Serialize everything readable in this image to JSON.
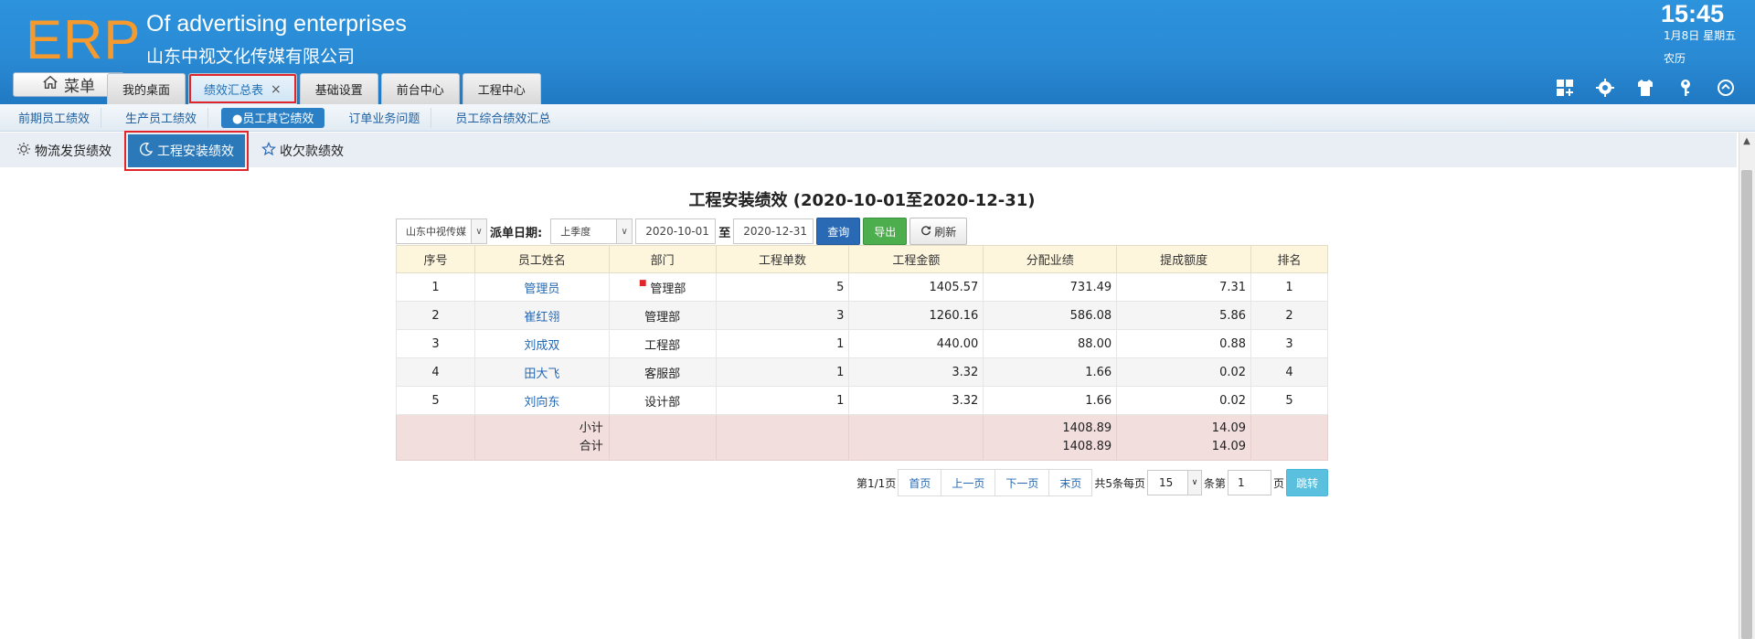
{
  "header": {
    "logo": "ERP",
    "company_en": "Of advertising enterprises",
    "company_cn": "山东中视文化传媒有限公司",
    "time": "15:45",
    "date": "1月8日 星期五",
    "lunar": "农历",
    "menu_label": "菜单",
    "tabs": [
      {
        "label": "我的桌面"
      },
      {
        "label": "绩效汇总表",
        "close": "×"
      },
      {
        "label": "基础设置"
      },
      {
        "label": "前台中心"
      },
      {
        "label": "工程中心"
      }
    ],
    "icons": [
      "apps-add-icon",
      "gear-icon",
      "shirt-icon",
      "key-icon",
      "collapse-up-icon"
    ]
  },
  "subnav": {
    "items": [
      "前期员工绩效",
      "生产员工绩效",
      "●员工其它绩效",
      "订单业务问题",
      "员工综合绩效汇总"
    ]
  },
  "section_tabs": {
    "items": [
      "物流发货绩效",
      "工程安装绩效",
      "收欠款绩效"
    ]
  },
  "report": {
    "title": "工程安装绩效 (2020-10-01至2020-12-31)",
    "filters": {
      "company_value": "山东中视传媒",
      "date_label": "派单日期:",
      "period_value": "上季度",
      "start_date": "2020-10-01",
      "to_label": "至",
      "end_date": "2020-12-31",
      "query_label": "查询",
      "export_label": "导出",
      "refresh_label": "刷新"
    },
    "columns": [
      "序号",
      "员工姓名",
      "部门",
      "工程单数",
      "工程金额",
      "分配业绩",
      "提成额度",
      "排名"
    ],
    "rows": [
      {
        "no": "1",
        "name": "管理员",
        "dept": "管理部",
        "orders": "5",
        "amount": "1405.57",
        "perf": "731.49",
        "commission": "7.31",
        "rank": "1"
      },
      {
        "no": "2",
        "name": "崔红翎",
        "dept": "管理部",
        "orders": "3",
        "amount": "1260.16",
        "perf": "586.08",
        "commission": "5.86",
        "rank": "2"
      },
      {
        "no": "3",
        "name": "刘成双",
        "dept": "工程部",
        "orders": "1",
        "amount": "440.00",
        "perf": "88.00",
        "commission": "0.88",
        "rank": "3"
      },
      {
        "no": "4",
        "name": "田大飞",
        "dept": "客服部",
        "orders": "1",
        "amount": "3.32",
        "perf": "1.66",
        "commission": "0.02",
        "rank": "4"
      },
      {
        "no": "5",
        "name": "刘向东",
        "dept": "设计部",
        "orders": "1",
        "amount": "3.32",
        "perf": "1.66",
        "commission": "0.02",
        "rank": "5"
      }
    ],
    "subtotal_label": "小计",
    "total_label": "合计",
    "subtotal_perf": "1408.89",
    "total_perf": "1408.89",
    "subtotal_commission": "14.09",
    "total_commission": "14.09"
  },
  "pager": {
    "page_info": "第1/1页",
    "first": "首页",
    "prev": "上一页",
    "next": "下一页",
    "last": "末页",
    "summary": "共5条每页",
    "page_size": "15",
    "goto_prefix": "条第",
    "goto_page": "1",
    "goto_suffix": "页",
    "jump_label": "跳转"
  }
}
